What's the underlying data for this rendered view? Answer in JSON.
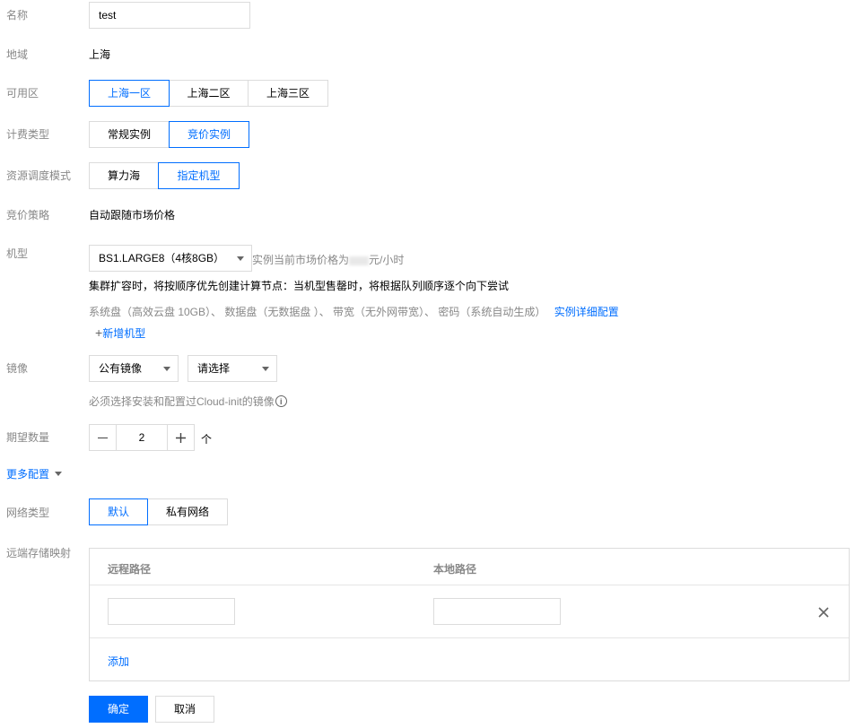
{
  "form": {
    "name": {
      "label": "名称",
      "value": "test"
    },
    "region": {
      "label": "地域",
      "value": "上海"
    },
    "zone": {
      "label": "可用区",
      "options": [
        "上海一区",
        "上海二区",
        "上海三区"
      ],
      "selected": "上海一区"
    },
    "billing": {
      "label": "计费类型",
      "options": [
        "常规实例",
        "竞价实例"
      ],
      "selected": "竞价实例"
    },
    "scheduling": {
      "label": "资源调度模式",
      "options": [
        "算力海",
        "指定机型"
      ],
      "selected": "指定机型"
    },
    "bid_strategy": {
      "label": "竞价策略",
      "value": "自动跟随市场价格"
    },
    "instance_type": {
      "label": "机型",
      "selected": "BS1.LARGE8（4核8GB）",
      "price_prefix": "实例当前市场价格为",
      "price_suffix": "元/小时",
      "note": "集群扩容时，将按顺序优先创建计算节点：当机型售罄时，将根据队列顺序逐个向下尝试",
      "details": "系统盘（高效云盘 10GB）、 数据盘（无数据盘 ）、 带宽（无外网带宽）、 密码（系统自动生成）",
      "details_link": "实例详细配置",
      "add_link": "新增机型"
    },
    "image": {
      "label": "镜像",
      "type_selected": "公有镜像",
      "image_placeholder": "请选择",
      "hint": "必须选择安装和配置过Cloud-init的镜像"
    },
    "quantity": {
      "label": "期望数量",
      "value": "2",
      "unit": "个"
    },
    "more_config": "更多配置",
    "network": {
      "label": "网络类型",
      "options": [
        "默认",
        "私有网络"
      ],
      "selected": "默认"
    },
    "storage": {
      "label": "远端存储映射",
      "col_remote": "远程路径",
      "col_local": "本地路径",
      "rows": [
        {
          "remote": "",
          "local": ""
        }
      ],
      "add": "添加"
    },
    "confirm": "确定",
    "cancel": "取消"
  },
  "colors": {
    "accent": "#006eff",
    "border": "#dcdcdc",
    "label": "#888888"
  }
}
